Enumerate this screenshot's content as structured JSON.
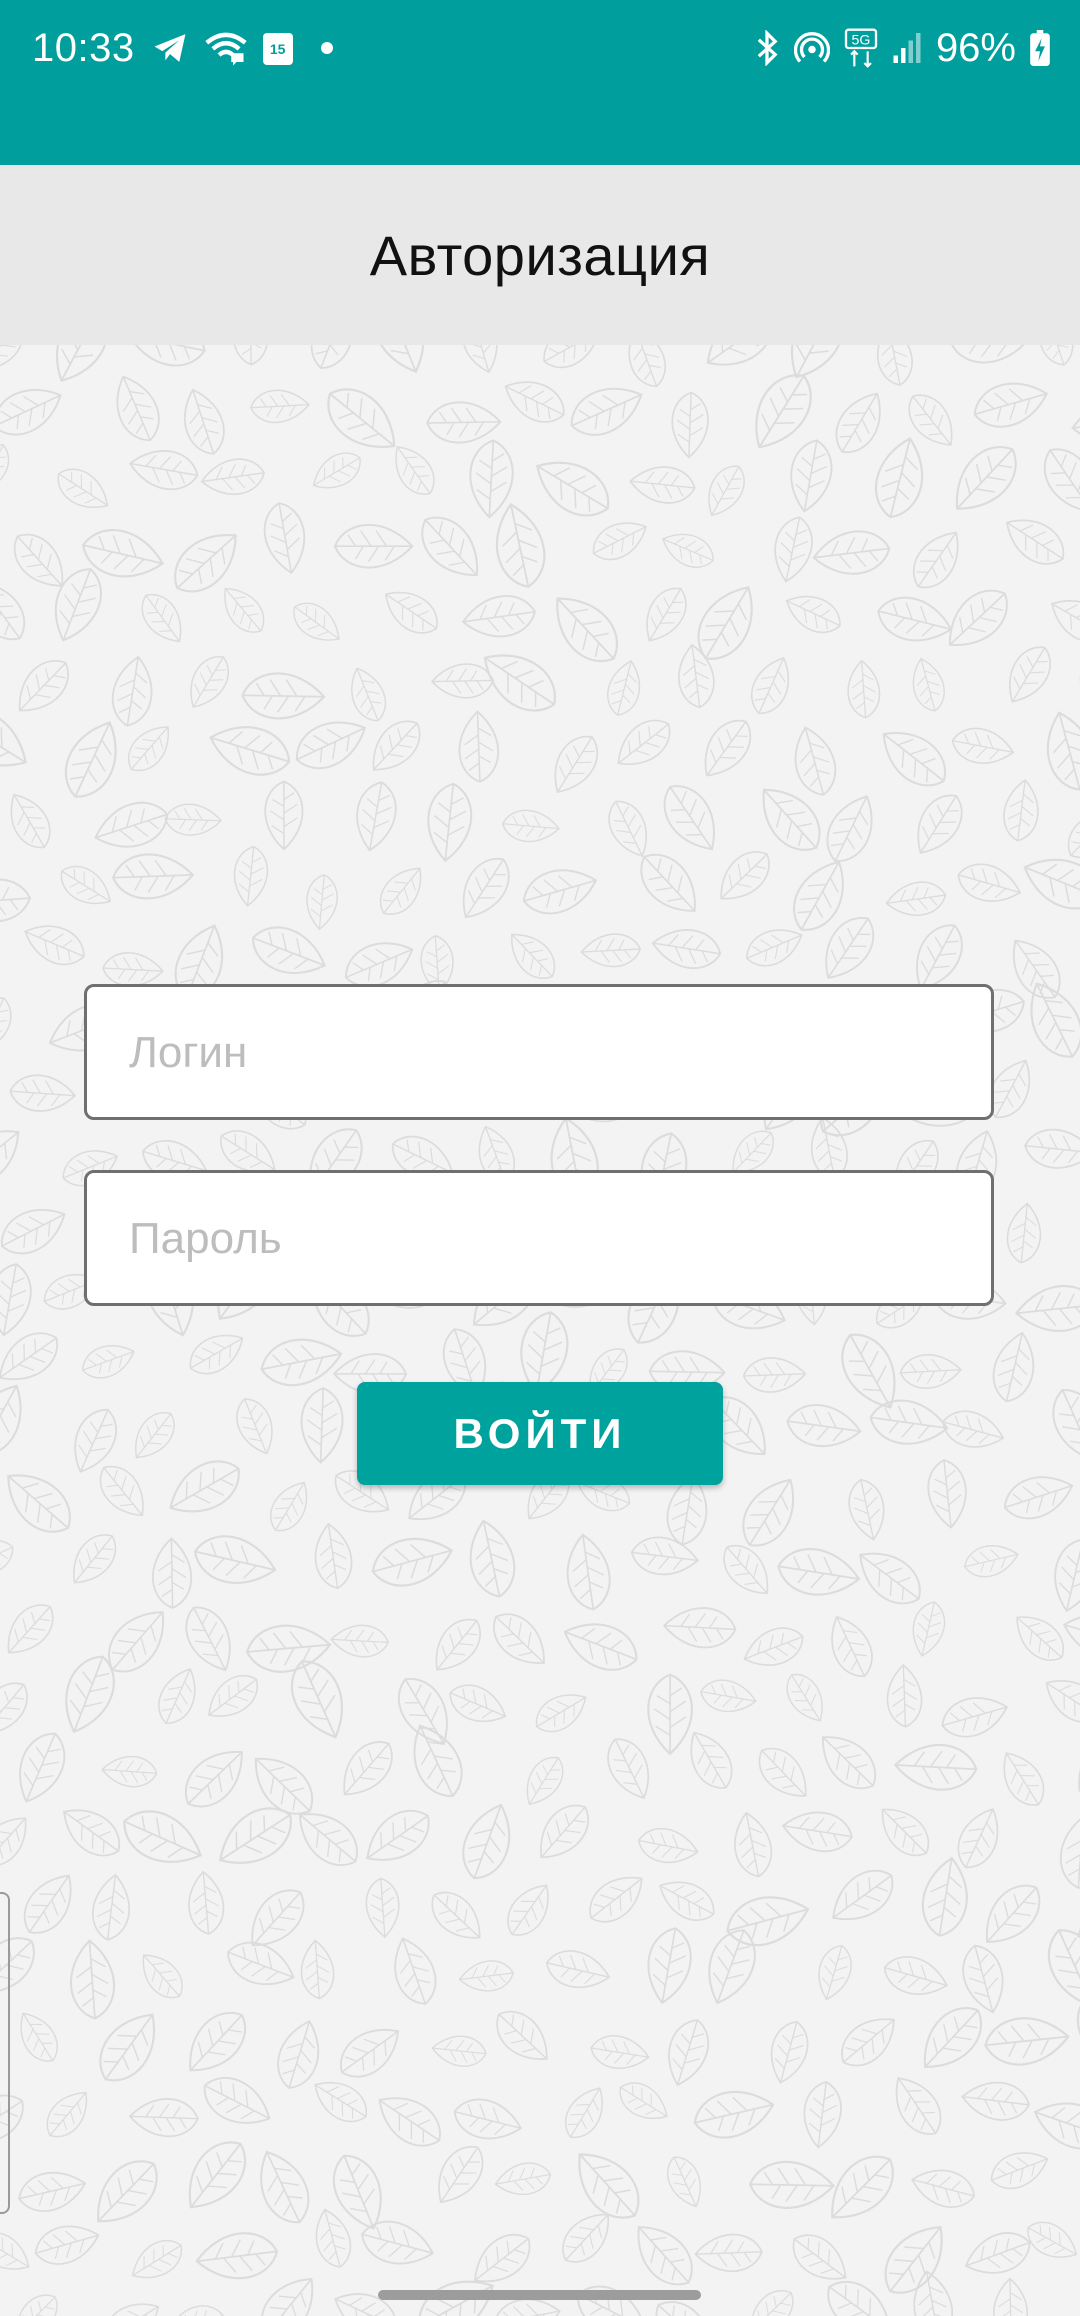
{
  "status_bar": {
    "time": "10:33",
    "calendar_day": "15",
    "network_label": "5G",
    "battery": "96%",
    "left_icons": [
      "telegram-icon",
      "wifi-calling-icon",
      "calendar-icon",
      "notification-dot-icon"
    ],
    "right_icons": [
      "bluetooth-icon",
      "hotspot-icon",
      "5g-icon",
      "signal-icon",
      "battery-charging-icon"
    ]
  },
  "header": {
    "title": "Авторизация"
  },
  "form": {
    "login_placeholder": "Логин",
    "login_value": "",
    "password_placeholder": "Пароль",
    "password_value": "",
    "submit_label": "ВОЙТИ"
  },
  "colors": {
    "primary": "#009e9c",
    "header_bg": "#e8e8e8",
    "page_bg": "#f3f3f3"
  }
}
